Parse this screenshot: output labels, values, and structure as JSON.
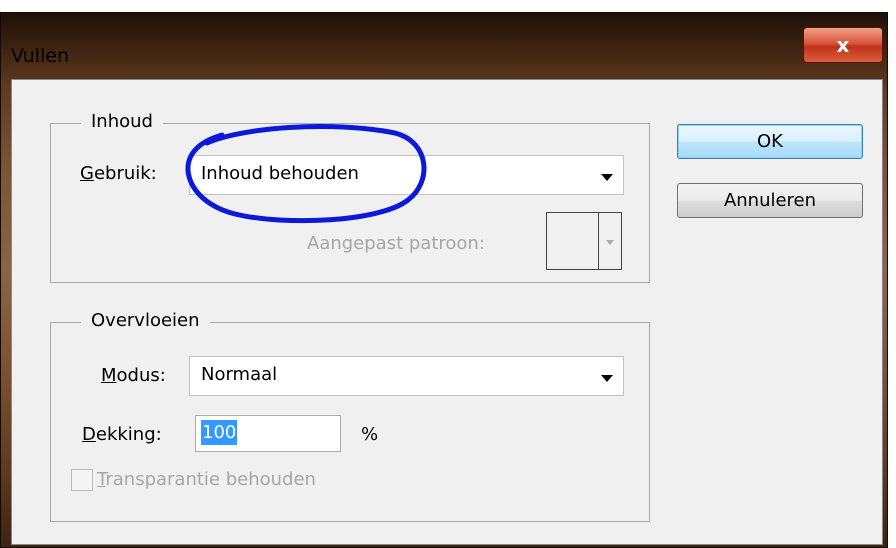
{
  "dialog": {
    "title": "Vullen",
    "close_label": "x"
  },
  "inhoud": {
    "legend": "Inhoud",
    "gebruik_label_first": "G",
    "gebruik_label_rest": "ebruik:",
    "gebruik_value": "Inhoud behouden",
    "pattern_label": "Aangepast patroon:",
    "highlight_color": "#0a1ad8"
  },
  "overvloeien": {
    "legend": "Overvloeien",
    "modus_label_first": "M",
    "modus_label_rest": "odus:",
    "modus_value": "Normaal",
    "dekking_label_first": "D",
    "dekking_label_rest": "ekking:",
    "dekking_value": "100",
    "dekking_unit": "%",
    "transparantie_first": "T",
    "transparantie_rest": "ransparantie behouden",
    "transparantie_checked": false
  },
  "buttons": {
    "ok": "OK",
    "cancel": "Annuleren"
  }
}
